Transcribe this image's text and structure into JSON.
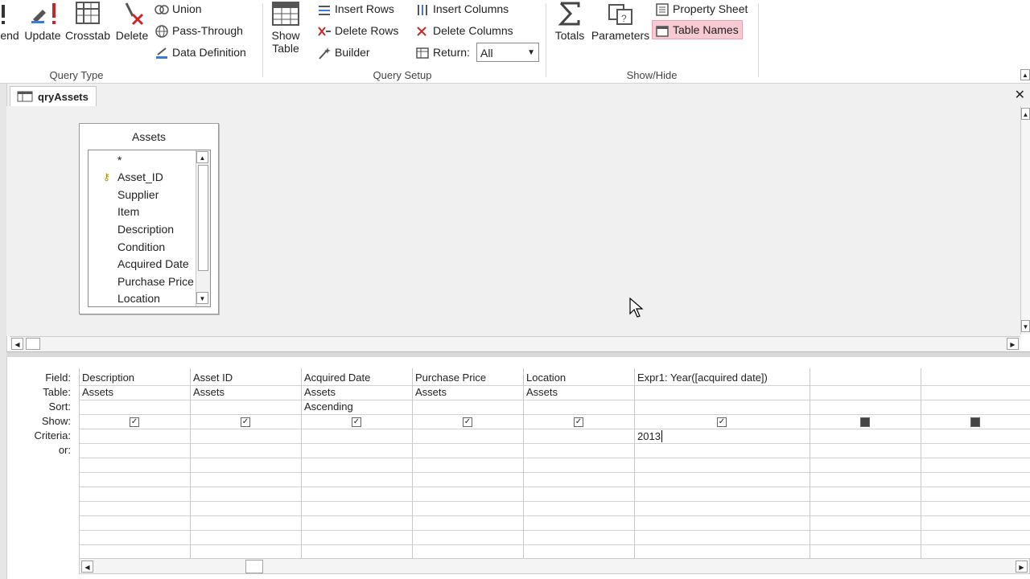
{
  "ribbon": {
    "query_type": {
      "label": "Query Type",
      "buttons": [
        "end",
        "Update",
        "Crosstab",
        "Delete"
      ],
      "small": [
        "Union",
        "Pass-Through",
        "Data Definition"
      ]
    },
    "query_setup": {
      "label": "Query Setup",
      "show_table": [
        "Show",
        "Table"
      ],
      "small_col1": [
        "Insert Rows",
        "Delete Rows",
        "Builder"
      ],
      "small_col2": [
        "Insert Columns",
        "Delete Columns",
        "Return:"
      ],
      "return_value": "All"
    },
    "show_hide": {
      "label": "Show/Hide",
      "totals": "Totals",
      "parameters": "Parameters",
      "property_sheet": "Property Sheet",
      "table_names": "Table Names"
    }
  },
  "doc_tab": {
    "label": "qryAssets",
    "close": "✕"
  },
  "table": {
    "title": "Assets",
    "fields": [
      "*",
      "Asset_ID",
      "Supplier",
      "Item",
      "Description",
      "Condition",
      "Acquired Date",
      "Purchase Price",
      "Location"
    ]
  },
  "grid": {
    "row_labels": [
      "Field:",
      "Table:",
      "Sort:",
      "Show:",
      "Criteria:",
      "or:"
    ],
    "columns": [
      {
        "field": "Description",
        "table": "Assets",
        "sort": "",
        "show": true,
        "criteria": ""
      },
      {
        "field": "Asset ID",
        "table": "Assets",
        "sort": "",
        "show": true,
        "criteria": ""
      },
      {
        "field": "Acquired Date",
        "table": "Assets",
        "sort": "Ascending",
        "show": true,
        "criteria": ""
      },
      {
        "field": "Purchase Price",
        "table": "Assets",
        "sort": "",
        "show": true,
        "criteria": ""
      },
      {
        "field": "Location",
        "table": "Assets",
        "sort": "",
        "show": true,
        "criteria": ""
      },
      {
        "field": "Expr1: Year([acquired date])",
        "table": "",
        "sort": "",
        "show": true,
        "criteria": "2013"
      },
      {
        "field": "",
        "table": "",
        "sort": "",
        "show": false,
        "criteria": ""
      },
      {
        "field": "",
        "table": "",
        "sort": "",
        "show": false,
        "criteria": ""
      }
    ]
  }
}
